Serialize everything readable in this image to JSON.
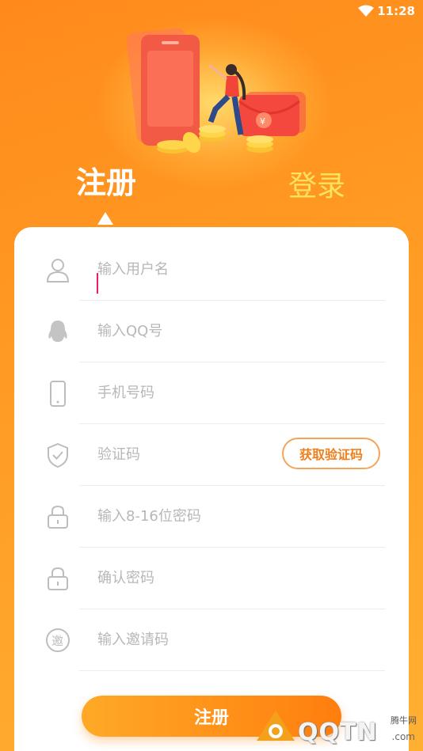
{
  "status_bar": {
    "time": "11:28"
  },
  "tabs": {
    "register": "注册",
    "login": "登录"
  },
  "form": {
    "username_placeholder": "输入用户名",
    "qq_placeholder": "输入QQ号",
    "phone_placeholder": "手机号码",
    "code_placeholder": "验证码",
    "get_code_label": "获取验证码",
    "password_placeholder": "输入8-16位密码",
    "confirm_password_placeholder": "确认密码",
    "invite_placeholder": "输入邀请码",
    "invite_icon_text": "邀",
    "submit_label": "注册"
  },
  "hero": {
    "currency_symbol": "¥"
  },
  "watermark": {
    "tag": "腾牛网",
    "brand": "QQTN",
    "suffix": ".com"
  },
  "colors": {
    "accent": "#ff8a1c",
    "login_tab": "#fde35e",
    "code_border": "#f5a45a"
  }
}
